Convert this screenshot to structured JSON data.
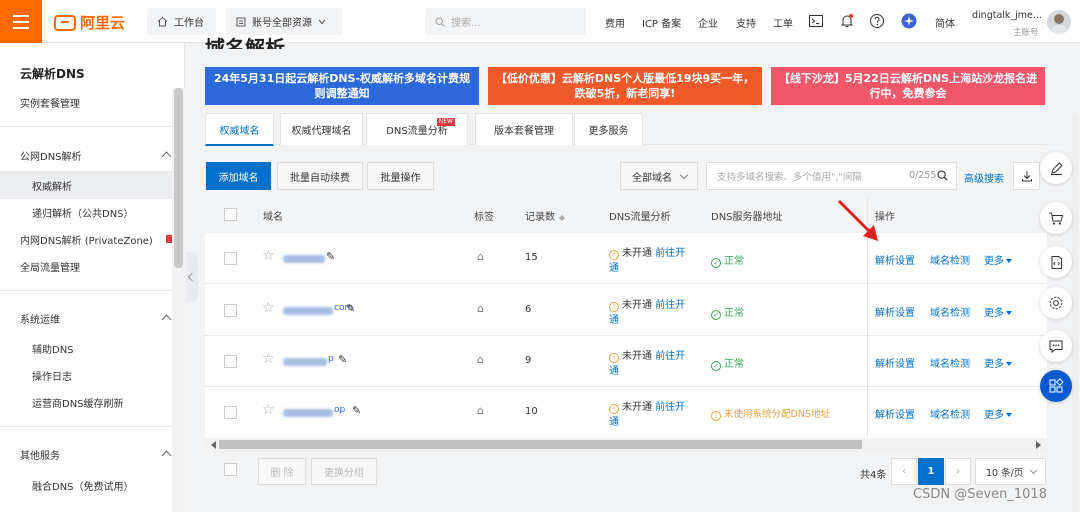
{
  "topbar": {
    "logo_text": "阿里云",
    "workbench": "工作台",
    "resource_selector": "账号全部资源",
    "search_placeholder": "搜索...",
    "nav": [
      "费用",
      "ICP 备案",
      "企业",
      "支持",
      "工单"
    ],
    "lang": "简体",
    "user_name": "dingtalk_jme...",
    "user_role": "主账号"
  },
  "sidebar": {
    "title": "云解析DNS",
    "instance_mgmt": "实例套餐管理",
    "public_dns": "公网DNS解析",
    "authoritative": "权威解析",
    "recursive": "递归解析（公共DNS）",
    "private_zone": "内网DNS解析 (PrivateZone)",
    "gtm": "全局流量管理",
    "ops": "系统运维",
    "aux_dns": "辅助DNS",
    "op_log": "操作日志",
    "isp_cache": "运营商DNS缓存刷新",
    "other": "其他服务",
    "fusion_dns": "融合DNS（免费试用）"
  },
  "page": {
    "title": "域名解析"
  },
  "banners": [
    {
      "text": "24年5月31日起云解析DNS-权威解析多域名计费规则调整通知",
      "color": "#2d6ad9"
    },
    {
      "text": "【低价优惠】云解析DNS个人版最低19块9买一年，跌破5折，新老同享!",
      "color": "#f0592a"
    },
    {
      "text": "【线下沙龙】5月22日云解析DNS上海站沙龙报名进行中，免费参会",
      "color": "#f0586a"
    }
  ],
  "tabs": [
    {
      "label": "权威域名",
      "active": true
    },
    {
      "label": "权威代理域名"
    },
    {
      "label": "DNS流量分析",
      "badge": "NEW"
    },
    {
      "label": "版本套餐管理"
    },
    {
      "label": "更多服务"
    }
  ],
  "toolbar": {
    "add_domain": "添加域名",
    "batch_renew": "批量自动续费",
    "batch_ops": "批量操作",
    "domain_filter": "全部域名",
    "search_placeholder": "支持多域名搜索、多个值用\",\"间隔",
    "search_count": "0/255",
    "advanced_search": "高级搜索"
  },
  "table": {
    "headers": {
      "domain": "域名",
      "tags": "标签",
      "records": "记录数",
      "dns_traffic": "DNS流量分析",
      "dns_server": "DNS服务器地址",
      "actions": "操作"
    },
    "rows": [
      {
        "domain_suffix": "",
        "records": "15",
        "traffic_status": "未开通",
        "traffic_link": "前往开",
        "traffic_link2": "通",
        "server_status": "正常",
        "server_ok": true
      },
      {
        "domain_suffix": "com",
        "records": "6",
        "traffic_status": "未开通",
        "traffic_link": "前往开",
        "traffic_link2": "通",
        "server_status": "正常",
        "server_ok": true
      },
      {
        "domain_suffix": "p",
        "records": "9",
        "traffic_status": "未开通",
        "traffic_link": "前往开",
        "traffic_link2": "通",
        "server_status": "正常",
        "server_ok": true
      },
      {
        "domain_suffix": "op",
        "records": "10",
        "traffic_status": "未开通",
        "traffic_link": "前往开",
        "traffic_link2": "通",
        "server_status": "未使用系统分配DNS地址",
        "server_ok": false
      }
    ],
    "row_actions": {
      "settings": "解析设置",
      "check": "域名检测",
      "more": "更多"
    }
  },
  "footer": {
    "delete": "删 除",
    "change_group": "更换分组",
    "total": "共4条",
    "page": "1",
    "page_size": "10 条/页"
  },
  "colors": {
    "brand": "#ff6a00",
    "primary": "#0070cc",
    "ok": "#3aa55a",
    "warn": "#e6a23c"
  },
  "watermark": "CSDN @Seven_1018"
}
